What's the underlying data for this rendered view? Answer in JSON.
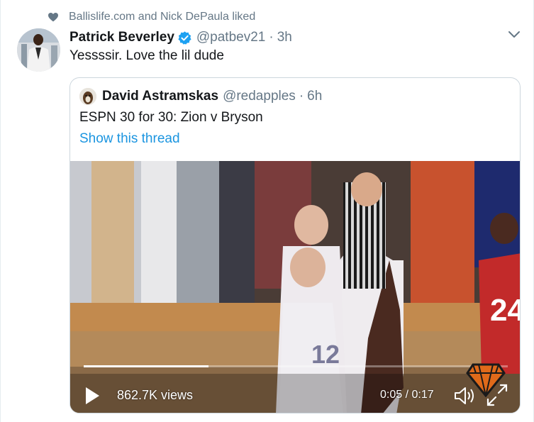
{
  "social_context": {
    "text": "Ballislife.com and Nick DePaula liked",
    "icon": "heart-icon"
  },
  "tweet": {
    "author_name": "Patrick Beverley",
    "handle": "@patbev21",
    "separator": "·",
    "time": "3h",
    "text": "Yessssir. Love the lil dude"
  },
  "quoted_tweet": {
    "author_name": "David Astramskas",
    "handle": "@redapples",
    "separator": "·",
    "time": "6h",
    "text": "ESPN 30 for 30: Zion v Bryson",
    "thread_link": "Show this thread"
  },
  "video": {
    "views": "862.7K views",
    "timecode": "0:05 / 0:17",
    "progress": 0.294
  },
  "colors": {
    "link": "#1b95e0",
    "verified": "#1da1f2",
    "secondary_text": "#657786",
    "border": "#ccd6dd"
  }
}
